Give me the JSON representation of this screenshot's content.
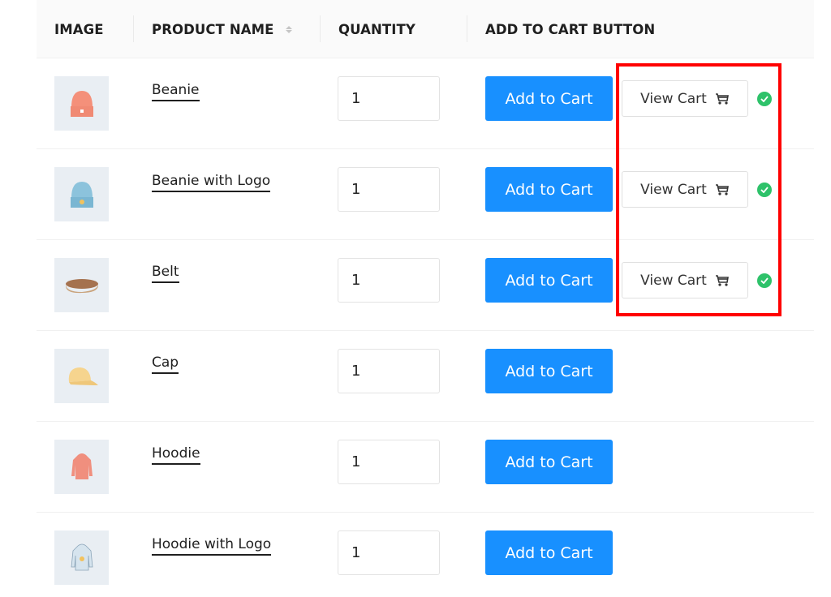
{
  "table": {
    "headers": {
      "image": "IMAGE",
      "product_name": "PRODUCT NAME",
      "quantity": "QUANTITY",
      "add_to_cart": "ADD TO CART BUTTON"
    },
    "rows": [
      {
        "name": "Beanie",
        "image_icon": "beanie-orange",
        "quantity": "1",
        "add_label": "Add to Cart",
        "view_cart_label": "View Cart",
        "added": true
      },
      {
        "name": "Beanie with Logo",
        "image_icon": "beanie-blue",
        "quantity": "1",
        "add_label": "Add to Cart",
        "view_cart_label": "View Cart",
        "added": true
      },
      {
        "name": "Belt",
        "image_icon": "belt",
        "quantity": "1",
        "add_label": "Add to Cart",
        "view_cart_label": "View Cart",
        "added": true
      },
      {
        "name": "Cap",
        "image_icon": "cap",
        "quantity": "1",
        "add_label": "Add to Cart",
        "added": false
      },
      {
        "name": "Hoodie",
        "image_icon": "hoodie-pink",
        "quantity": "1",
        "add_label": "Add to Cart",
        "added": false
      },
      {
        "name": "Hoodie with Logo",
        "image_icon": "hoodie-blue",
        "quantity": "1",
        "add_label": "Add to Cart",
        "added": false
      }
    ]
  },
  "colors": {
    "primary": "#1890ff",
    "success": "#2ec26a",
    "highlight": "#ff0000"
  }
}
